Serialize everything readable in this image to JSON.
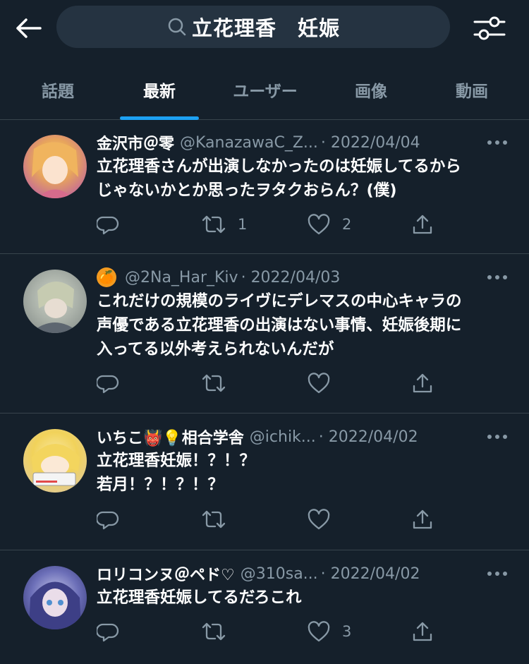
{
  "header": {
    "search_query": "立花理香　妊娠"
  },
  "tabs": [
    {
      "label": "話題"
    },
    {
      "label": "最新"
    },
    {
      "label": "ユーザー"
    },
    {
      "label": "画像"
    },
    {
      "label": "動画"
    }
  ],
  "active_tab": "最新",
  "tweets": [
    {
      "name": "金沢市＠零",
      "handle": "@KanazawaC_Z...",
      "date": "· 2022/04/04",
      "lines": [
        "立花理香さんが出演しなかったのは妊娠してるから",
        "じゃないかとか思ったヲタクおらん？(僕)"
      ],
      "retweets": "1",
      "likes": "2"
    },
    {
      "name": "🍊",
      "handle": "@2Na_Har_Kiv",
      "date": "· 2022/04/03",
      "lines": [
        "これだけの規模のライヴにデレマスの中心キャラの",
        "声優である立花理香の出演はない事情、妊娠後期に",
        "入ってる以外考えられないんだが"
      ],
      "retweets": "",
      "likes": ""
    },
    {
      "name": "いちこ👹💡相合学舎",
      "handle": "@ichik...",
      "date": "· 2022/04/02",
      "lines": [
        "立花理香妊娠！？！？",
        "若月！？！？！？"
      ],
      "retweets": "",
      "likes": ""
    },
    {
      "name": "ロリコンヌ＠ペド♡",
      "handle": "@310sa...",
      "date": "· 2022/04/02",
      "lines": [
        "立花理香妊娠してるだろこれ"
      ],
      "retweets": "",
      "likes": "3"
    }
  ],
  "colors": {
    "background": "#15202b",
    "accent": "#1da1f2",
    "muted": "#8899a6",
    "divider": "#38444d"
  }
}
